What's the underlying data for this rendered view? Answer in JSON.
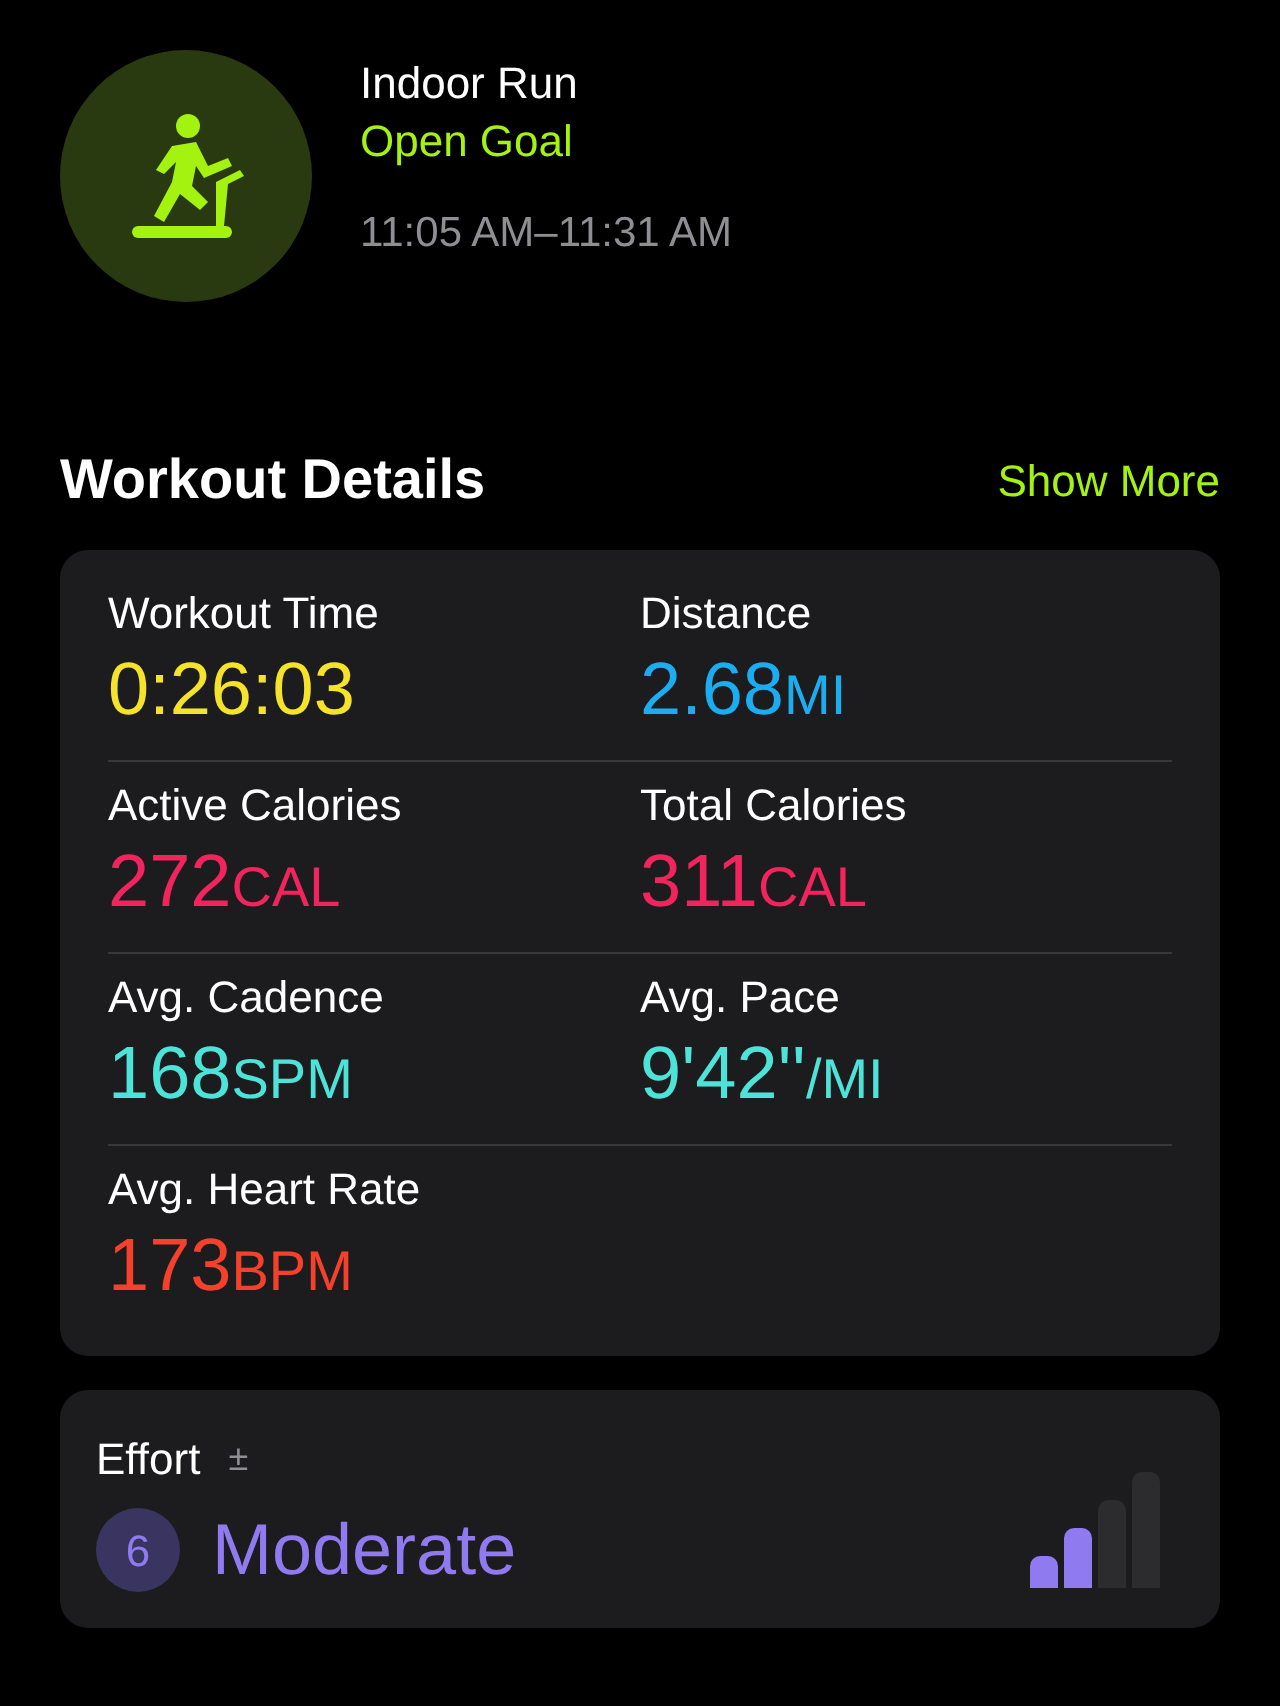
{
  "workout": {
    "title": "Indoor Run",
    "goal": "Open Goal",
    "time_range": "11:05 AM–11:31 AM"
  },
  "details": {
    "title": "Workout Details",
    "show_more": "Show More",
    "metrics": [
      {
        "label": "Workout Time",
        "value": "0:26:03",
        "color": "#f5e22b"
      },
      {
        "label": "Distance",
        "value": "2.68",
        "unit": "MI",
        "color": "#1badf0"
      },
      {
        "label": "Active Calories",
        "value": "272",
        "unit": "CAL",
        "color": "#f2245d"
      },
      {
        "label": "Total Calories",
        "value": "311",
        "unit": "CAL",
        "color": "#f2245d"
      },
      {
        "label": "Avg. Cadence",
        "value": "168",
        "unit": "SPM",
        "color": "#4de3d8"
      },
      {
        "label": "Avg. Pace",
        "value": "9'42''",
        "unit": "/MI",
        "color": "#4de3d8"
      },
      {
        "label": "Avg. Heart Rate",
        "value": "173",
        "unit": "BPM",
        "color": "#f5412c"
      }
    ]
  },
  "effort": {
    "label": "Effort",
    "adjust": "±",
    "score": "6",
    "rating": "Moderate",
    "level": 0.5
  }
}
